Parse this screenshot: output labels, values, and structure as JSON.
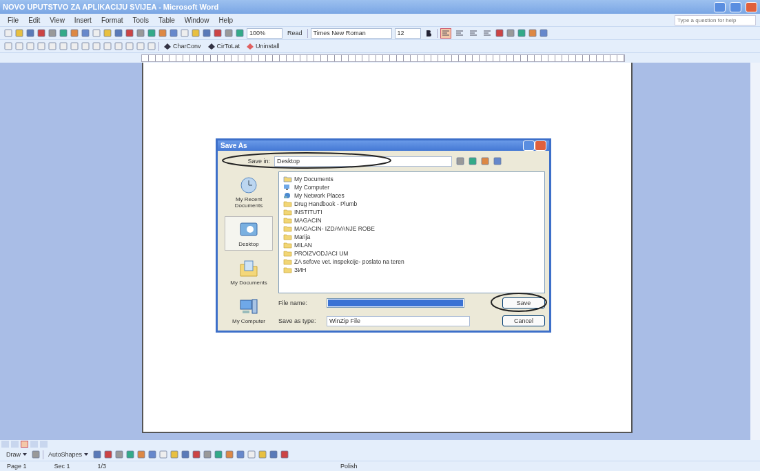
{
  "window": {
    "title": "NOVO UPUTSTVO ZA APLIKACIJU SVIJEA - Microsoft Word"
  },
  "menu": [
    "File",
    "Edit",
    "View",
    "Insert",
    "Format",
    "Tools",
    "Table",
    "Window",
    "Help"
  ],
  "help_search": {
    "placeholder": "Type a question for help"
  },
  "formatting": {
    "zoom": "100%",
    "read": "Read",
    "font": "Times New Roman",
    "size": "12",
    "align_buttons": [
      {
        "selected": true
      },
      {
        "selected": false
      },
      {
        "selected": false
      },
      {
        "selected": false
      }
    ]
  },
  "addins": [
    "CharConv",
    "CirToLat",
    "Uninstall"
  ],
  "dialog": {
    "title": "Save As",
    "save_in_label": "Save in:",
    "save_in": "Desktop",
    "places": [
      {
        "label": "My Recent Documents",
        "kind": "recent",
        "selected": false
      },
      {
        "label": "Desktop",
        "kind": "desktop",
        "selected": true
      },
      {
        "label": "My Documents",
        "kind": "documents",
        "selected": false
      },
      {
        "label": "My Computer",
        "kind": "computer",
        "selected": false
      }
    ],
    "files": [
      {
        "name": "My Documents",
        "kind": "documents"
      },
      {
        "name": "My Computer",
        "kind": "computer"
      },
      {
        "name": "My Network Places",
        "kind": "network"
      },
      {
        "name": "Drug Handbook - Plumb",
        "kind": "folder"
      },
      {
        "name": "INSTITUTI",
        "kind": "folder"
      },
      {
        "name": "MAGACIN",
        "kind": "folder"
      },
      {
        "name": "MAGACIN- IZDAVANJE ROBE",
        "kind": "folder"
      },
      {
        "name": "Marija",
        "kind": "folder"
      },
      {
        "name": "MILAN",
        "kind": "folder"
      },
      {
        "name": "PROIZVODJACI UM",
        "kind": "folder"
      },
      {
        "name": "ZA sefove vet. inspekcije- poslato na teren",
        "kind": "folder"
      },
      {
        "name": "ЗИН",
        "kind": "folder"
      }
    ],
    "file_name_label": "File name:",
    "save_type_label": "Save as type:",
    "save_type": "WinZip File",
    "buttons": [
      "Save",
      "Cancel"
    ]
  },
  "view_buttons": [
    {
      "selected": false
    },
    {
      "selected": false
    },
    {
      "selected": true
    },
    {
      "selected": false
    },
    {
      "selected": false
    }
  ],
  "drawing": {
    "draw": "Draw",
    "autoshapes": "AutoShapes"
  },
  "status_bar": {
    "page": "Page 1",
    "section": "Sec 1",
    "pages": "1/3",
    "language": "Polish"
  }
}
